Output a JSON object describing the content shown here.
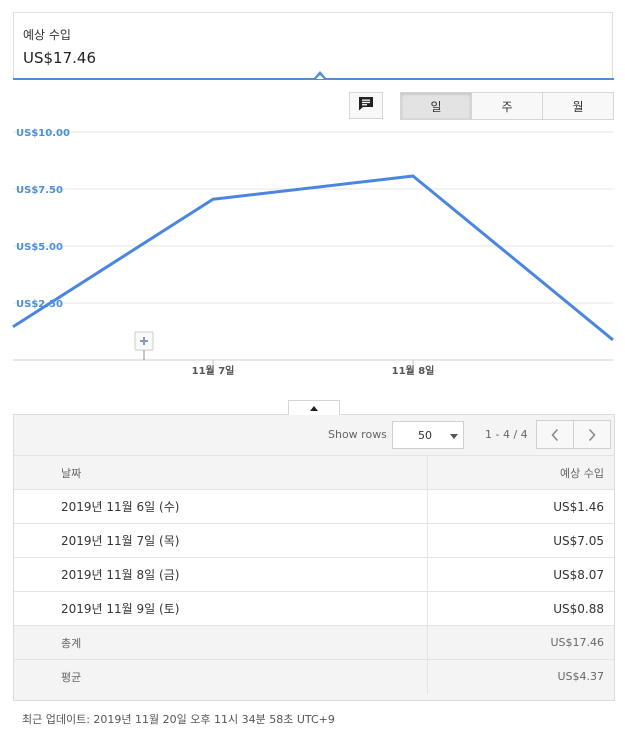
{
  "summary": {
    "title": "예상 수입",
    "value": "US$17.46"
  },
  "toolbar": {
    "comment_icon": "comment-icon",
    "periods": [
      {
        "label": "일",
        "active": true
      },
      {
        "label": "주",
        "active": false
      },
      {
        "label": "월",
        "active": false
      }
    ]
  },
  "chart_data": {
    "type": "line",
    "x": [
      "2019-11-06",
      "2019-11-07",
      "2019-11-08",
      "2019-11-09"
    ],
    "series": [
      {
        "values": [
          1.46,
          7.05,
          8.07,
          0.88
        ],
        "color": "#4a86e0"
      }
    ],
    "xtick_labels": [
      "11월 7일",
      "11월 8일"
    ],
    "yticks": [
      "US$10.00",
      "US$7.50",
      "US$5.00",
      "US$2.50"
    ],
    "ylim": [
      0,
      10
    ],
    "grid": true,
    "annotation_marker": "plus-icon"
  },
  "table": {
    "show_rows_label": "Show rows",
    "rows_per_page": "50",
    "page_range": "1 - 4 / 4",
    "headers": {
      "date": "날짜",
      "value": "예상 수입"
    },
    "rows": [
      {
        "date": "2019년 11월 6일 (수)",
        "value": "US$1.46"
      },
      {
        "date": "2019년 11월 7일 (목)",
        "value": "US$7.05"
      },
      {
        "date": "2019년 11월 8일 (금)",
        "value": "US$8.07"
      },
      {
        "date": "2019년 11월 9일 (토)",
        "value": "US$0.88"
      }
    ],
    "totals": [
      {
        "label": "총계",
        "value": "US$17.46"
      },
      {
        "label": "평균",
        "value": "US$4.37"
      }
    ]
  },
  "footer": {
    "last_updated": "최근 업데이트: 2019년 11월 20일 오후 11시 34분 58초 UTC+9"
  },
  "colors": {
    "accent": "#4a8fd8",
    "line": "#4a86e0",
    "axis_label": "#4a8fd8"
  }
}
